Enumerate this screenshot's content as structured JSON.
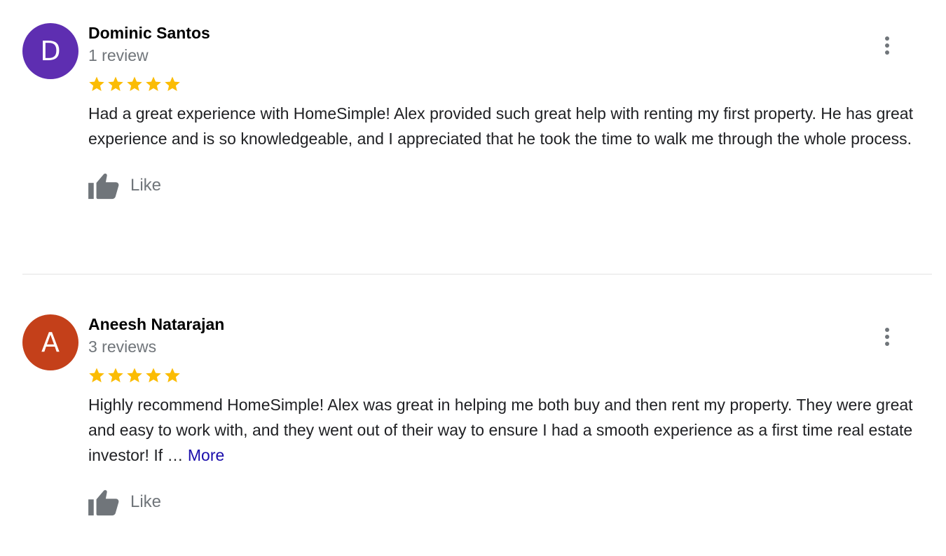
{
  "reviews": [
    {
      "avatar_letter": "D",
      "avatar_color": "#5e2eb1",
      "name": "Dominic Santos",
      "review_count": "1 review",
      "rating": 5,
      "rating_max": 5,
      "text": "Had a great experience with HomeSimple! Alex provided such great help with renting my first property. He has great experience and is so knowledgeable, and I appreciated that he took the time to walk me through the whole process.",
      "more_label": "",
      "like_label": "Like"
    },
    {
      "avatar_letter": "A",
      "avatar_color": "#c4401a",
      "name": "Aneesh Natarajan",
      "review_count": "3 reviews",
      "rating": 5,
      "rating_max": 5,
      "text": "Highly recommend HomeSimple! Alex was great in helping me both buy and then rent my property. They were great and easy to work with, and they went out of their way to ensure I had a smooth experience as a first time real estate investor! If … ",
      "more_label": "More",
      "like_label": "Like"
    }
  ],
  "colors": {
    "star": "#fbbc04",
    "link": "#1a0dab",
    "muted": "#70757a"
  },
  "icons": {
    "star": "star-icon",
    "like": "thumbs-up-icon",
    "menu": "more-vert-icon"
  }
}
